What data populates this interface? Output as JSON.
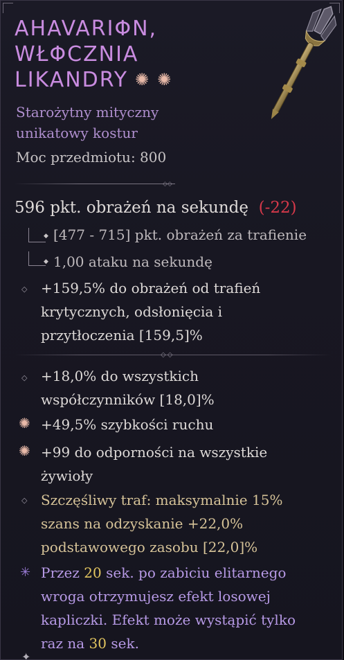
{
  "item": {
    "title_lines": [
      "AHAVARIΦN,",
      "WŁΦCZNIA",
      "LIKANDRY"
    ],
    "type_line": "Starożytny mityczny unikatowy kostur",
    "power": "Moc przedmiotu: 800",
    "icons": {
      "title_stars": "sun-star-icon",
      "weapon": "spear-staff-icon"
    }
  },
  "dps": {
    "label": "596 pkt. obrażeń na sekundę",
    "delta": "-22"
  },
  "stats": [
    "[477 - 715] pkt. obrażeń za trafienie",
    "1,00 ataku na sekundę"
  ],
  "implicit": "+159,5% do obrażeń od trafień krytycznych, odsłonięcia i przytłoczenia [159,5]%",
  "affixes": [
    {
      "text": "+18,0% do wszystkich współczynników [18,0]%",
      "icon": "diamond-bullet-icon"
    },
    {
      "text": "+49,5% szybkości ruchu",
      "icon": "greater-affix-star-icon"
    },
    {
      "text": "+99 do odporności na wszystkie żywioły",
      "icon": "greater-affix-star-icon"
    },
    {
      "text": "Szczęśliwy traf: maksymalnie 15% szans na odzyskanie +22,0% podstawowego zasobu [22,0]%",
      "icon": "diamond-bullet-icon"
    }
  ],
  "unique_power": {
    "parts": [
      "Przez ",
      "20",
      " sek. po zabiciu elitarnego wroga otrzymujesz efekt losowej kapliczki. Efekt może wystąpić tylko raz na ",
      "30",
      " sek."
    ],
    "icon": "unique-power-star-icon"
  },
  "colors": {
    "title": "#c98ce0",
    "type": "#b08fcf",
    "negative": "#d6394a",
    "lucky_hit": "#d6c398",
    "unique_text": "#b79ae6",
    "highlight_number": "#e2c560"
  }
}
